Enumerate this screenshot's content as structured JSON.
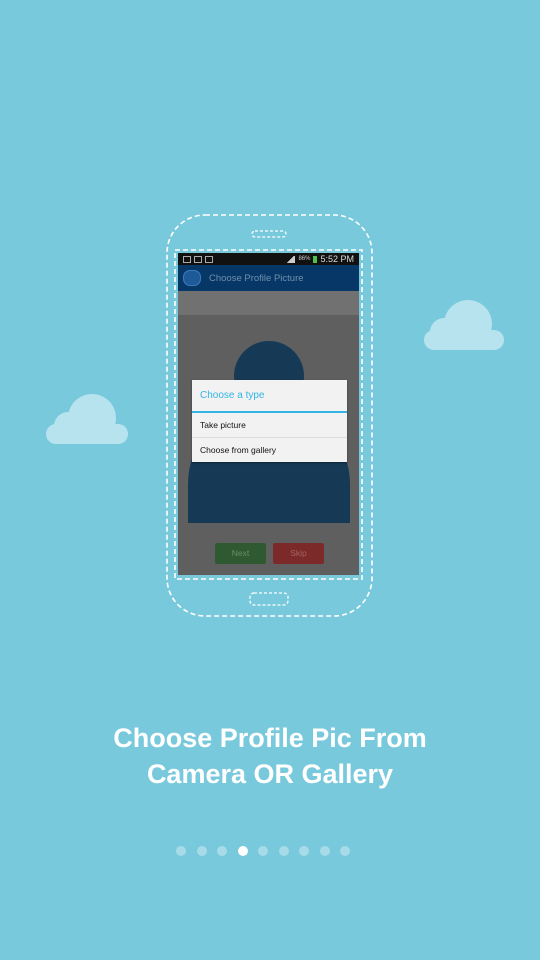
{
  "screen": {
    "status_bar": {
      "battery_text": "86%",
      "time": "5:52 PM"
    },
    "action_bar": {
      "title": "Choose Profile Picture"
    },
    "dialog": {
      "title": "Choose a type",
      "items": [
        "Take picture",
        "Choose from gallery"
      ]
    },
    "buttons": {
      "next": "Next",
      "skip": "Skip"
    }
  },
  "caption": {
    "line1": "Choose Profile Pic From",
    "line2": "Camera OR Gallery"
  },
  "pager": {
    "total": 9,
    "active_index": 3
  },
  "colors": {
    "background": "#79c9dd",
    "accent": "#33b5e5",
    "cloud": "#b7e3ee"
  }
}
